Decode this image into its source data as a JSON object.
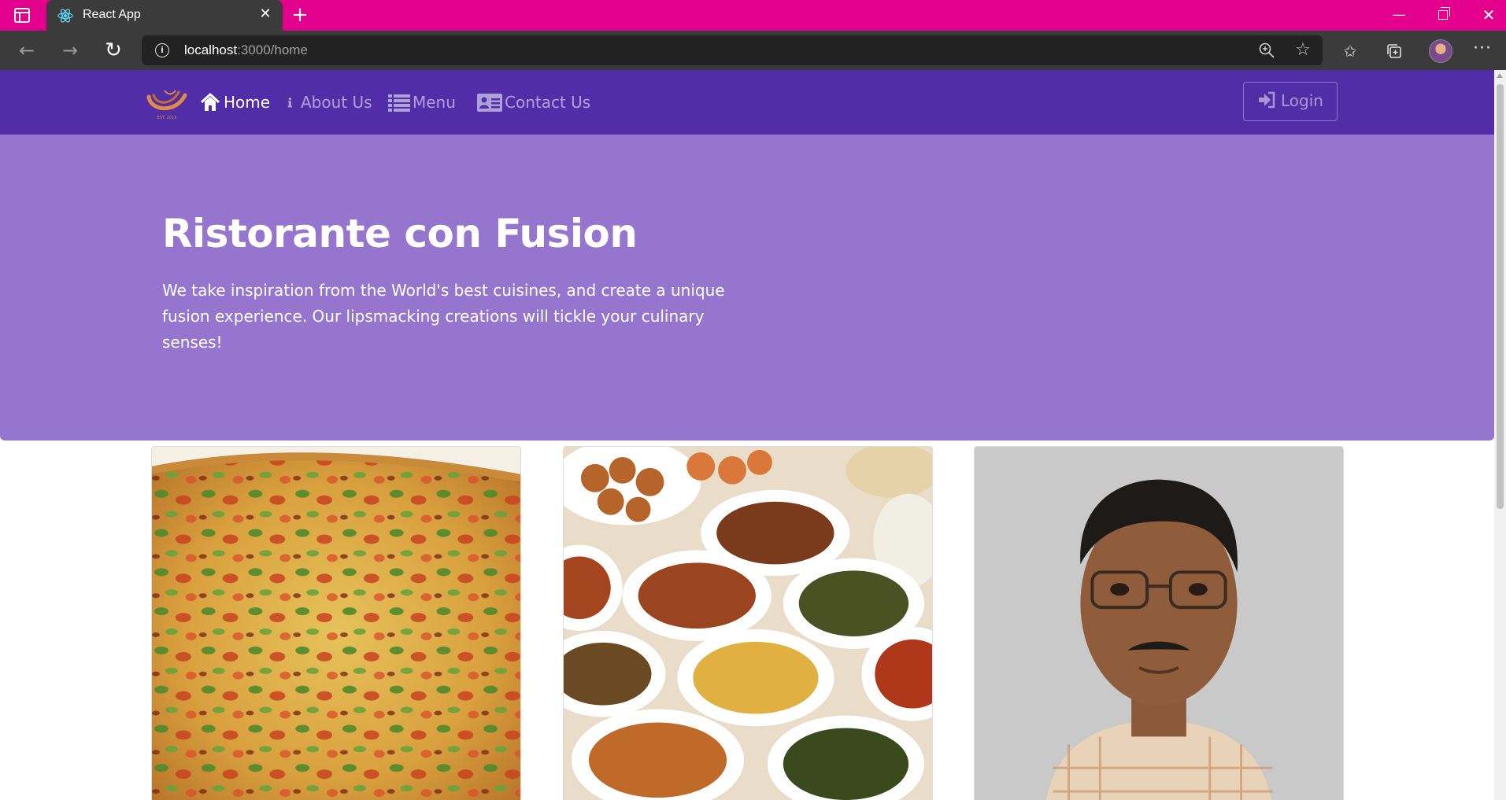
{
  "browser": {
    "tab_title": "React App",
    "tab_close": "✕",
    "new_tab": "+",
    "window_controls": {
      "minimize": "—",
      "close": "✕"
    },
    "url_host": "localhost",
    "url_path": ":3000/home",
    "more_menu": "···",
    "icons": [
      "sidebar-icon",
      "react-favicon-icon",
      "back-icon",
      "forward-icon",
      "reload-icon",
      "site-info-icon",
      "zoom-icon",
      "add-favorite-icon",
      "favorites-icon",
      "collections-icon",
      "profile-avatar",
      "more-icon"
    ],
    "accent_color": "#e3008c"
  },
  "site": {
    "nav": {
      "home": "Home",
      "about": "About Us",
      "menu": "Menu",
      "contact": "Contact Us",
      "login": "Login",
      "logo_text": "EST. 2013",
      "active": "home"
    },
    "jumbotron": {
      "title": "Ristorante con Fusion",
      "text": "We take inspiration from the World's best cuisines, and create a unique fusion experience. Our lipsmacking creations will tickle your culinary senses!"
    },
    "cards": [
      {
        "image": "uthappizza-image"
      },
      {
        "image": "buffet-image"
      },
      {
        "image": "chef-portrait-image"
      }
    ],
    "colors": {
      "navbar": "#512da8",
      "jumbotron": "#9575cd",
      "logo": "#e08a4a"
    }
  }
}
